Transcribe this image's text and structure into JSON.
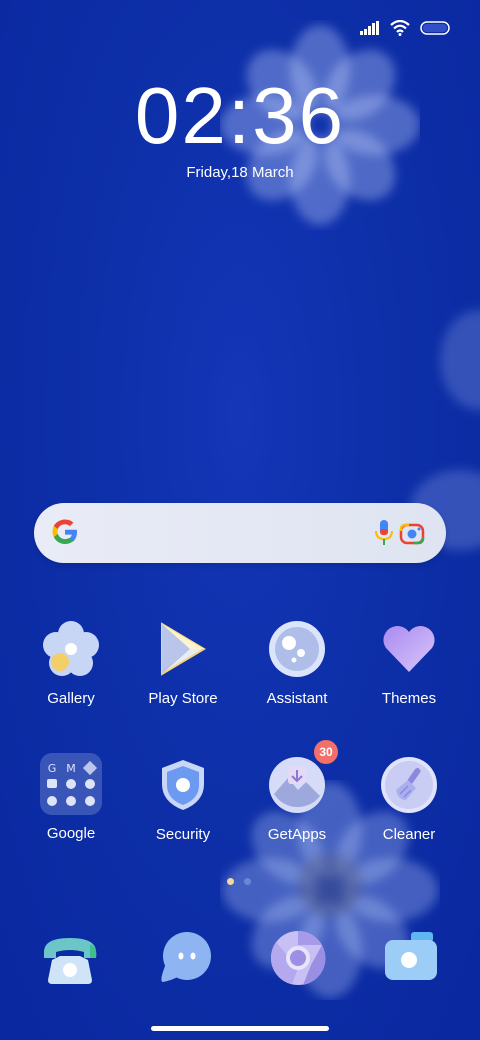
{
  "status": {
    "signal_icon": "signal-icon",
    "wifi_icon": "wifi-icon",
    "battery_icon": "battery-icon"
  },
  "clock": {
    "time": "02:36",
    "date": "Friday,18 March"
  },
  "search": {
    "google_icon": "google-g-icon",
    "mic_icon": "mic-icon",
    "lens_icon": "lens-icon"
  },
  "apps_row1": [
    {
      "label": "Gallery"
    },
    {
      "label": "Play Store"
    },
    {
      "label": "Assistant"
    },
    {
      "label": "Themes"
    }
  ],
  "apps_row2": [
    {
      "label": "Google"
    },
    {
      "label": "Security"
    },
    {
      "label": "GetApps",
      "badge": "30"
    },
    {
      "label": "Cleaner"
    }
  ],
  "dock": [
    "phone-icon",
    "messages-icon",
    "chrome-icon",
    "camera-icon"
  ],
  "colors": {
    "background": "#0d2fa8",
    "badge": "#f36f6a",
    "accent": "#ffffff"
  }
}
